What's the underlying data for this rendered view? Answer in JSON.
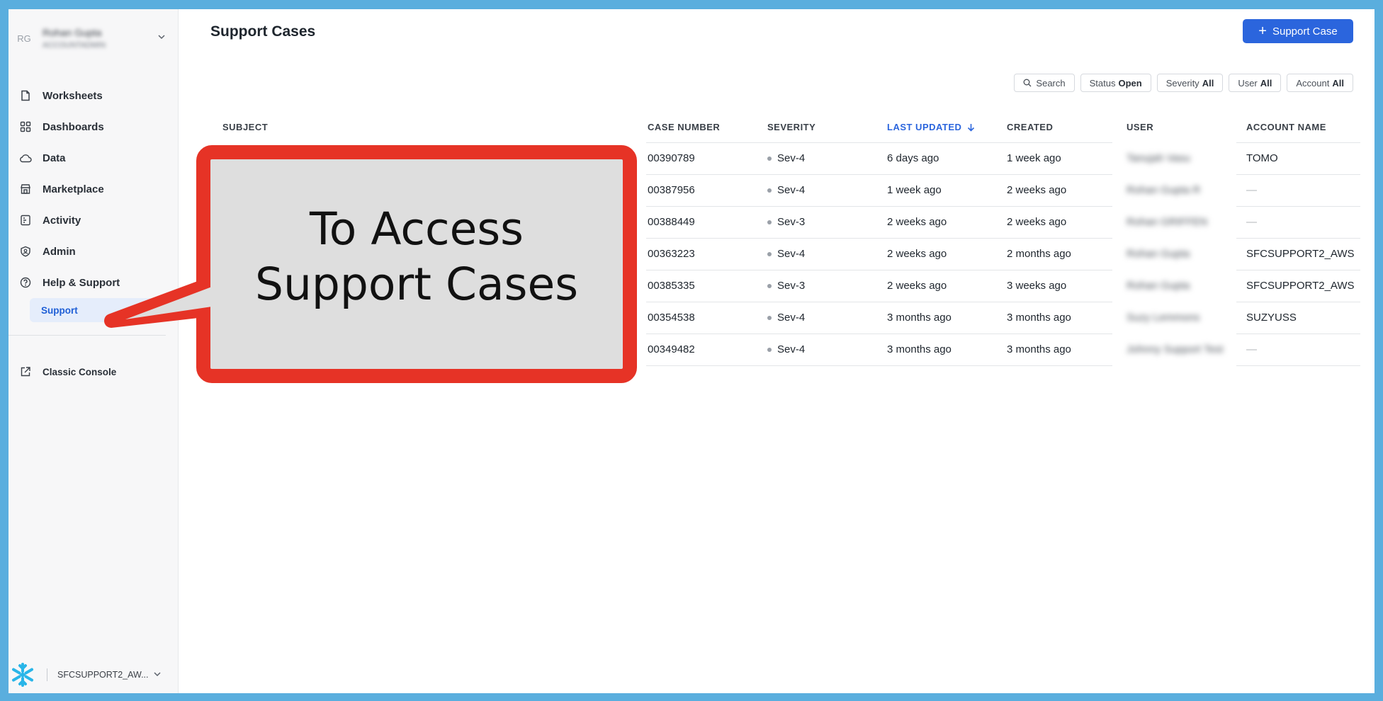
{
  "sidebar": {
    "avatar": "RG",
    "user_name": "Rohan Gupta",
    "user_role": "ACCOUNTADMIN",
    "items": [
      {
        "label": "Worksheets",
        "icon": "file-icon"
      },
      {
        "label": "Dashboards",
        "icon": "grid-icon"
      },
      {
        "label": "Data",
        "icon": "cloud-icon"
      },
      {
        "label": "Marketplace",
        "icon": "store-icon"
      },
      {
        "label": "Activity",
        "icon": "activity-icon"
      },
      {
        "label": "Admin",
        "icon": "shield-icon"
      },
      {
        "label": "Help & Support",
        "icon": "help-icon"
      }
    ],
    "sub_item": "Support",
    "classic_console": "Classic Console",
    "account": "SFCSUPPORT2_AW..."
  },
  "header": {
    "title": "Support Cases",
    "new_case_label": "Support Case"
  },
  "filters": {
    "search": "Search",
    "status_label": "Status",
    "status_value": "Open",
    "severity_label": "Severity",
    "severity_value": "All",
    "user_label": "User",
    "user_value": "All",
    "account_label": "Account",
    "account_value": "All"
  },
  "table": {
    "columns": {
      "subject": "SUBJECT",
      "case_number": "CASE NUMBER",
      "severity": "SEVERITY",
      "last_updated": "LAST UPDATED",
      "created": "CREATED",
      "user": "USER",
      "account_name": "ACCOUNT NAME"
    },
    "rows": [
      {
        "case_number": "00390789",
        "severity": "Sev-4",
        "last_updated": "6 days ago",
        "created": "1 week ago",
        "user": "Tanujah Vasu",
        "account_name": "TOMO"
      },
      {
        "case_number": "00387956",
        "severity": "Sev-4",
        "last_updated": "1 week ago",
        "created": "2 weeks ago",
        "user": "Rohan Gupta R",
        "account_name": "—"
      },
      {
        "case_number": "00388449",
        "severity": "Sev-3",
        "last_updated": "2 weeks ago",
        "created": "2 weeks ago",
        "user": "Rohan GRIFFEN",
        "account_name": "—"
      },
      {
        "case_number": "00363223",
        "severity": "Sev-4",
        "last_updated": "2 weeks ago",
        "created": "2 months ago",
        "user": "Rohan Gupta",
        "account_name": "SFCSUPPORT2_AWS"
      },
      {
        "case_number": "00385335",
        "severity": "Sev-3",
        "last_updated": "2 weeks ago",
        "created": "3 weeks ago",
        "user": "Rohan Gupta",
        "account_name": "SFCSUPPORT2_AWS"
      },
      {
        "case_number": "00354538",
        "severity": "Sev-4",
        "last_updated": "3 months ago",
        "created": "3 months ago",
        "user": "Suzy Lemmons",
        "account_name": "SUZYUSS"
      },
      {
        "case_number": "00349482",
        "severity": "Sev-4",
        "last_updated": "3 months ago",
        "created": "3 months ago",
        "user": "Johnny Support Test",
        "account_name": "—"
      }
    ]
  },
  "callout": {
    "line1": "To Access",
    "line2": "Support Cases",
    "border_color": "#e63326",
    "fill_color": "#dedede"
  },
  "colors": {
    "accent": "#2b65dd",
    "frame": "#5aaede"
  }
}
